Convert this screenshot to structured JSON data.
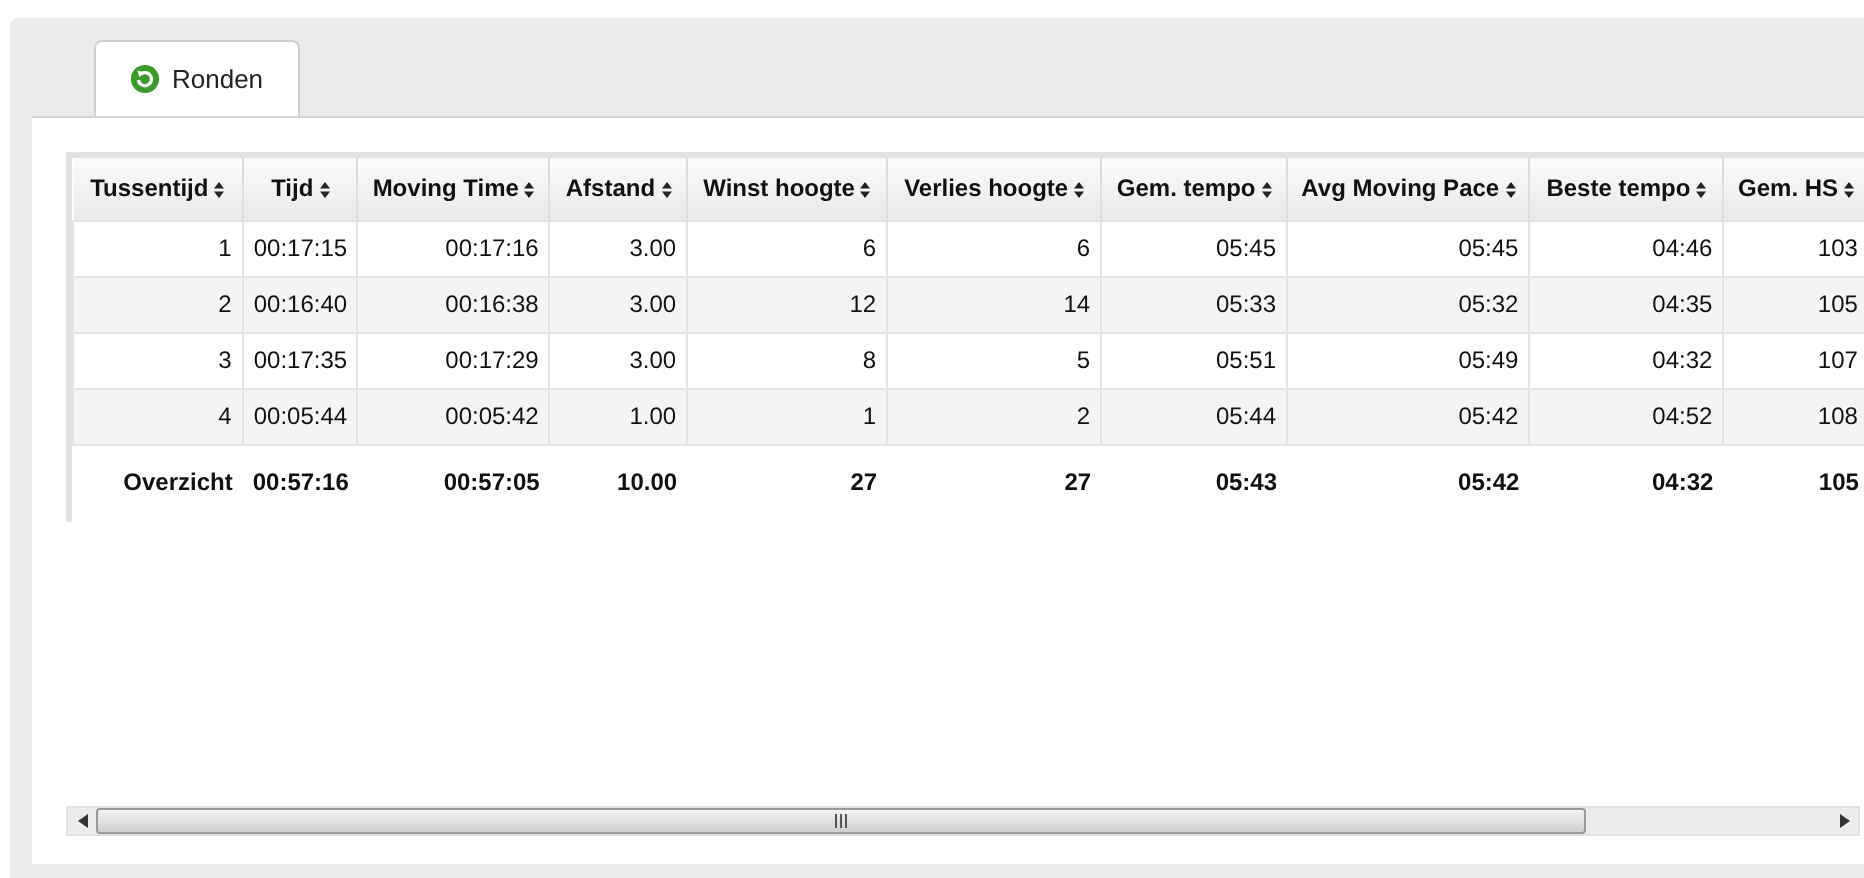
{
  "tabs": [
    {
      "label": "Ronden",
      "selected": true
    }
  ],
  "table": {
    "columns": [
      "Tussentijd",
      "Tijd",
      "Moving Time",
      "Afstand",
      "Winst hoogte",
      "Verlies hoogte",
      "Gem. tempo",
      "Avg Moving Pace",
      "Beste tempo",
      "Gem. HS"
    ],
    "rows": [
      [
        "1",
        "00:17:15",
        "00:17:16",
        "3.00",
        "6",
        "6",
        "05:45",
        "05:45",
        "04:46",
        "103"
      ],
      [
        "2",
        "00:16:40",
        "00:16:38",
        "3.00",
        "12",
        "14",
        "05:33",
        "05:32",
        "04:35",
        "105"
      ],
      [
        "3",
        "00:17:35",
        "00:17:29",
        "3.00",
        "8",
        "5",
        "05:51",
        "05:49",
        "04:32",
        "107"
      ],
      [
        "4",
        "00:05:44",
        "00:05:42",
        "1.00",
        "1",
        "2",
        "05:44",
        "05:42",
        "04:52",
        "108"
      ]
    ],
    "summary": [
      "Overzicht",
      "00:57:16",
      "00:57:05",
      "10.00",
      "27",
      "27",
      "05:43",
      "05:42",
      "04:32",
      "105"
    ]
  }
}
